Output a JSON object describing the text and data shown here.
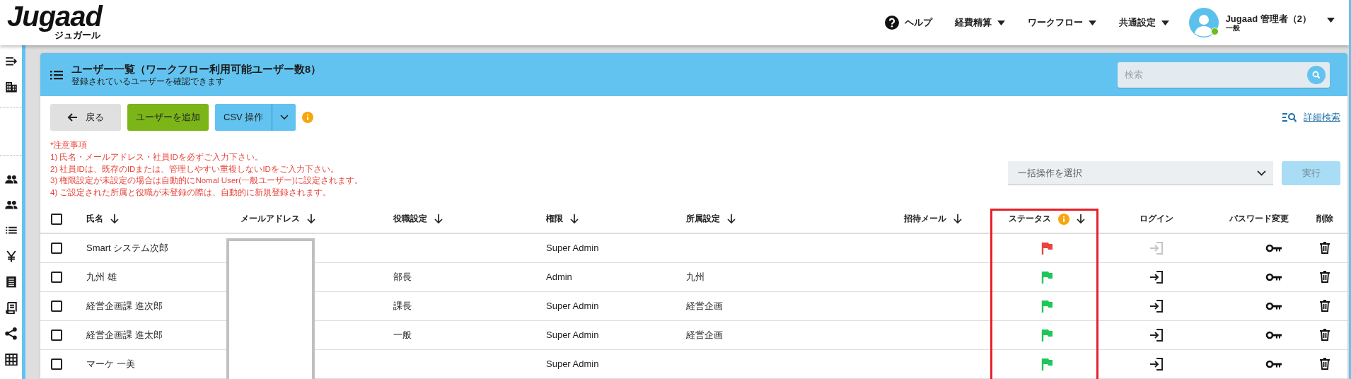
{
  "header": {
    "logo": "Jugaad",
    "logo_sub": "ジュガール",
    "nav": [
      {
        "label": "ヘルプ",
        "kind": "help"
      },
      {
        "label": "経費精算",
        "kind": "menu"
      },
      {
        "label": "ワークフロー",
        "kind": "menu"
      },
      {
        "label": "共通設定",
        "kind": "menu"
      }
    ],
    "user": {
      "name": "Jugaad 管理者（2）",
      "role": "一般",
      "online": true
    }
  },
  "page": {
    "title": "ユーザー一覧（ワークフロー利用可能ユーザー数8）",
    "subtitle": "登録されているユーザーを確認できます",
    "search": {
      "placeholder": "検索"
    }
  },
  "toolbar": {
    "buttons": [
      {
        "label": "戻る",
        "kind": "back"
      },
      {
        "label": "ユーザーを追加",
        "kind": "add"
      },
      {
        "label": "CSV 操作",
        "kind": "split"
      }
    ],
    "advanced_search": "詳細検索"
  },
  "notes": [
    "*注意事項",
    "1) 氏名・メールアドレス・社員IDを必ずご入力下さい。",
    "2) 社員IDは、既存のIDまたは、管理しやすい重複しないIDをご入力下さい。",
    "3) 権限設定が未設定の場合は自動的にNomal User(一般ユーザー)に設定されます。",
    "4) ご設定された所属と役職が未登録の際は、自動的に新規登録されます。"
  ],
  "bulk": {
    "placeholder": "一括操作を選択",
    "button": "実行",
    "button_disabled": true
  },
  "table": {
    "select_all_checked": false,
    "columns": [
      {
        "label": "氏名",
        "sortable": true,
        "info": false
      },
      {
        "label": "メールアドレス",
        "sortable": true,
        "info": false,
        "redacted": true
      },
      {
        "label": "役職設定",
        "sortable": true,
        "info": false
      },
      {
        "label": "権限",
        "sortable": true,
        "info": false
      },
      {
        "label": "所属設定",
        "sortable": true,
        "info": false
      },
      {
        "label": "招待メール",
        "sortable": true,
        "info": false
      },
      {
        "label": "ステータス",
        "sortable": true,
        "info": true,
        "highlighted": true
      },
      {
        "label": "ログイン",
        "sortable": false,
        "info": false
      },
      {
        "label": "パスワード変更",
        "sortable": false,
        "info": false
      },
      {
        "label": "削除",
        "sortable": false,
        "info": false
      }
    ],
    "rows": [
      {
        "checked": false,
        "name": "Smart システム次郎",
        "permission": "Super Admin",
        "flag": {
          "color": "#e8453c"
        },
        "login_enabled": false
      },
      {
        "checked": false,
        "name": "九州 雄",
        "role": "部長",
        "permission": "Admin",
        "department": "九州",
        "flag": {
          "color": "#1fc65a"
        },
        "login_enabled": true
      },
      {
        "checked": false,
        "name": "経営企画課 進次郎",
        "role": "課長",
        "permission": "Super Admin",
        "department": "経営企画",
        "flag": {
          "color": "#1fc65a"
        },
        "login_enabled": true
      },
      {
        "checked": false,
        "name": "経営企画課 進太郎",
        "role": "一般",
        "permission": "Super Admin",
        "department": "経営企画",
        "flag": {
          "color": "#1fc65a"
        },
        "login_enabled": true
      },
      {
        "checked": false,
        "name": "マーケ 一美",
        "permission": "Super Admin",
        "flag": {
          "color": "#1fc65a"
        },
        "login_enabled": true
      }
    ]
  }
}
